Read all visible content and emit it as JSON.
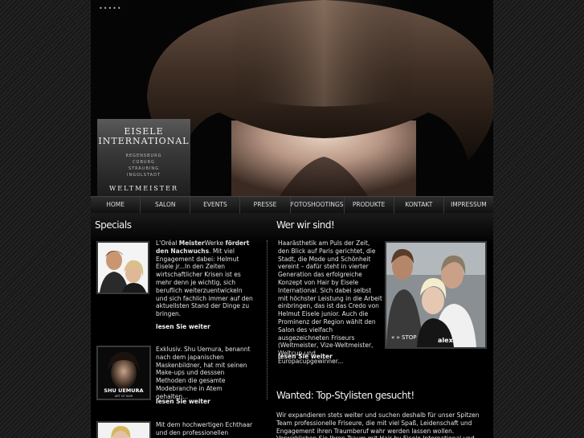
{
  "hero": {
    "dots": "•••••"
  },
  "logo": {
    "line1": "EISELE",
    "line2": "INTERNATIONAL",
    "cities": [
      "REGENSBURG",
      "COBURG",
      "STRAUBING",
      "INGOLSTADT"
    ],
    "tagline": "WELTMEISTER"
  },
  "nav": [
    "HOME",
    "SALON",
    "EVENTS",
    "PRESSE",
    "FOTOSHOOTINGS",
    "PRODUKTE",
    "KONTAKT",
    "IMPRESSUM"
  ],
  "specials": {
    "title": "Specials",
    "item1": {
      "pre": "L'Oréal ",
      "bold1": "Meister",
      "mid": "Werke ",
      "bold2": "fördert den Nachwuchs",
      "rest": ". Mit viel Engagement dabei: Helmut Eisele jr...In den Zeiten wirtschaftlicher Krisen ist es mehr denn je wichtig, sich beruflich weiterzuentwickeln und sich fachlich immer auf den aktuellsten Stand der Dinge zu bringen.",
      "more": "lesen Sie weiter"
    },
    "item2": {
      "text": "Exklusiv. Shu Uemura, benannt nach dem japanischen Maskenbildner, hat mit seinen Make-ups und desssen Methoden die gesamte Modebranche in Atem gehalten...",
      "more": "lesen Sie weiter",
      "img_brand": "SHU UEMURA",
      "img_sub": "ART OF HAIR"
    },
    "item3": {
      "text": "Mit dem hochwertigen Echthaar und den professionellen"
    }
  },
  "about": {
    "title": "Wer wir sind!",
    "text": "Haarästhetik am Puls der Zeit, den Blick auf Paris gerichtet, die Stadt, die Mode und Schönheit vereint – dafür steht in vierter Generation das erfolgreiche Konzept von Hair by Eisele International. Sich dabei selbst mit höchster Leistung in die Arbeit einbringen, das ist das Credo von Helmut Eisele junior. Auch die Prominenz der Region wählt den Salon des vielfach ausgezeichneten Friseurs (Weltmeister, Vize-Weltmeister, Weltcup und Europacupgewinner...",
    "more": "lesen Sie weiter",
    "slider_controls": "« » STOP"
  },
  "wanted": {
    "title": "Wanted: Top-Stylisten gesucht!",
    "text": "Wir expandieren stets weiter und suchen deshalb für unser Spitzen Team professionelle Friseure, die mit viel Spaß, Leidenschaft und Engagement ihren Traumberuf wahr werden lassen wollen. Verwirklichen Sie Ihren Traum mit Hair by Eisele International und bewerben Sie sich noch heute!"
  }
}
